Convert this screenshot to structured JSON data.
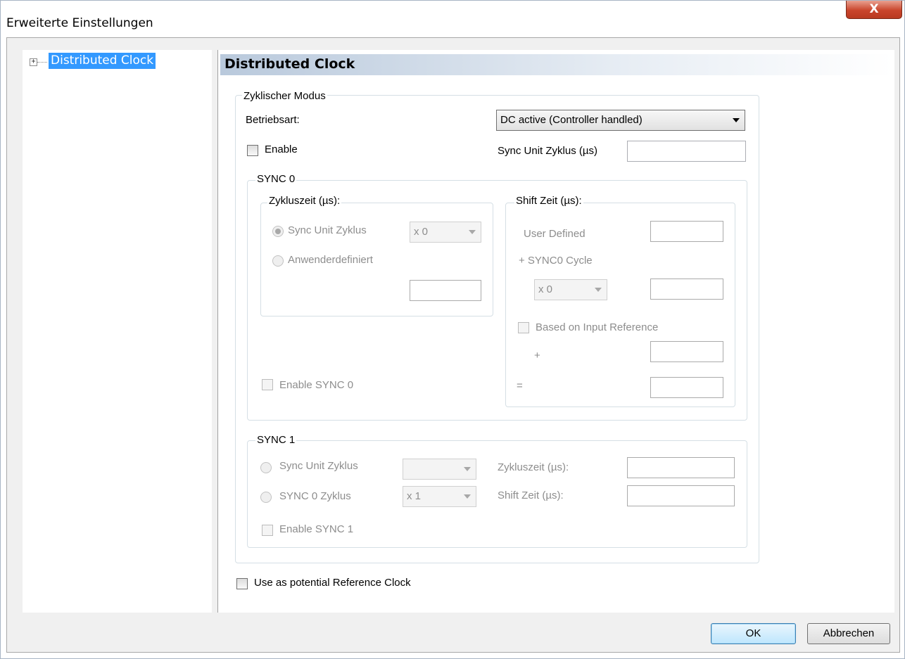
{
  "window": {
    "title": "Erweiterte Einstellungen",
    "close_label": "X"
  },
  "tree": {
    "expander": "+",
    "items": [
      {
        "label": "Distributed Clock",
        "selected": true
      }
    ]
  },
  "panel": {
    "header": "Distributed Clock",
    "zyklischer_modus": {
      "legend": "Zyklischer Modus",
      "betriebsart_label": "Betriebsart:",
      "betriebsart_value": "DC active (Controller handled)",
      "enable_label": "Enable",
      "sync_unit_zyklus_label": "Sync Unit Zyklus (µs)",
      "sync_unit_zyklus_value": ""
    },
    "sync0": {
      "legend": "SYNC 0",
      "zykluszeit": {
        "legend": "Zykluszeit (µs):",
        "radio_sync_unit": "Sync Unit Zyklus",
        "multiplier": "x 0",
        "radio_anwender": "Anwenderdefiniert",
        "value": ""
      },
      "shift": {
        "legend": "Shift Zeit (µs):",
        "user_defined_label": "User Defined",
        "user_defined_value": "",
        "sync0_cycle_label": "+ SYNC0 Cycle",
        "multiplier": "x 0",
        "cycle_value": "",
        "based_on_input_label": "Based on Input Reference",
        "plus_label": "+",
        "plus_value": "",
        "equals_label": "=",
        "equals_value": ""
      },
      "enable_label": "Enable SYNC 0"
    },
    "sync1": {
      "legend": "SYNC 1",
      "radio_sync_unit": "Sync Unit Zyklus",
      "sync_unit_select": "",
      "radio_sync0": "SYNC 0 Zyklus",
      "sync0_select": "x 1",
      "zykluszeit_label": "Zykluszeit (µs):",
      "zykluszeit_value": "",
      "shift_label": "Shift Zeit (µs):",
      "shift_value": "",
      "enable_label": "Enable SYNC 1"
    },
    "reference_clock_label": "Use as potential Reference Clock"
  },
  "footer": {
    "ok_label": "OK",
    "cancel_label": "Abbrechen"
  }
}
